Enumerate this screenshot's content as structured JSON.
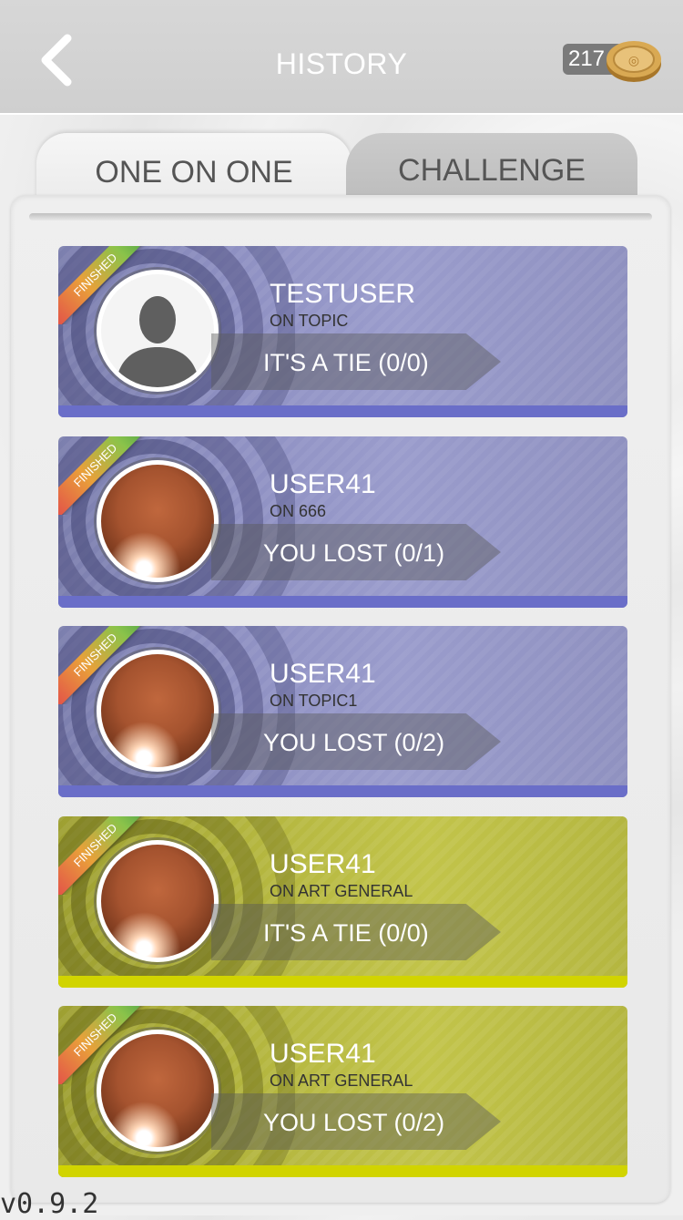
{
  "header": {
    "title": "HISTORY",
    "coins": "217"
  },
  "tabs": [
    {
      "label": "ONE ON ONE",
      "active": true
    },
    {
      "label": "CHALLENGE",
      "active": false
    }
  ],
  "matches": [
    {
      "badge": "FINISHED",
      "name": "TESTUSER",
      "topic": "ON TOPIC",
      "result": "IT'S A TIE (0/0)",
      "color": "purple",
      "avatar": "default-avatar-icon"
    },
    {
      "badge": "FINISHED",
      "name": "USER41",
      "topic": "ON 666",
      "result": "YOU LOST (0/1)",
      "color": "purple",
      "avatar": "planet-avatar"
    },
    {
      "badge": "FINISHED",
      "name": "USER41",
      "topic": "ON TOPIC1",
      "result": "YOU LOST (0/2)",
      "color": "purple",
      "avatar": "planet-avatar"
    },
    {
      "badge": "FINISHED",
      "name": "USER41",
      "topic": "ON ART GENERAL",
      "result": "IT'S A TIE (0/0)",
      "color": "olive",
      "avatar": "planet-avatar"
    },
    {
      "badge": "FINISHED",
      "name": "USER41",
      "topic": "ON ART GENERAL",
      "result": "YOU LOST (0/2)",
      "color": "olive",
      "avatar": "planet-avatar"
    }
  ],
  "version": "v0.9.2"
}
